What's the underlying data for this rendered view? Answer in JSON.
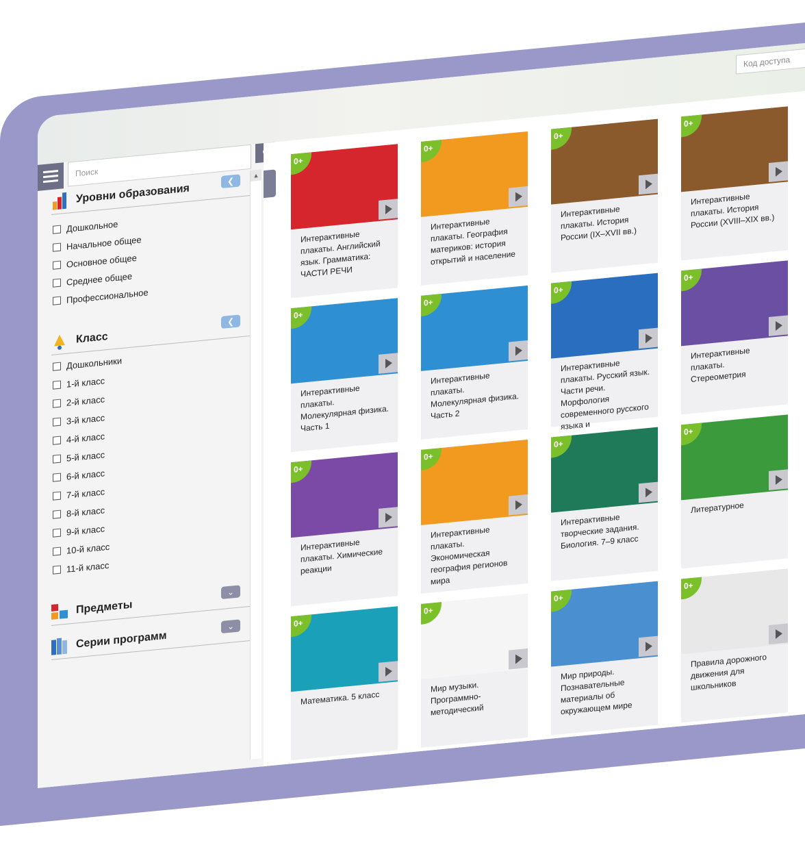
{
  "header": {
    "access_placeholder": "Код доступа"
  },
  "search": {
    "placeholder": "Поиск"
  },
  "sidebar": {
    "levels": {
      "title": "Уровни образования",
      "items": [
        "Дошкольное",
        "Начальное общее",
        "Основное общее",
        "Среднее общее",
        "Профессиональное"
      ]
    },
    "classes": {
      "title": "Класс",
      "items": [
        "Дошкольники",
        "1-й класс",
        "2-й класс",
        "3-й класс",
        "4-й класс",
        "5-й класс",
        "6-й класс",
        "7-й класс",
        "8-й класс",
        "9-й класс",
        "10-й класс",
        "11-й класс"
      ]
    },
    "subjects": {
      "title": "Предметы"
    },
    "series": {
      "title": "Серии программ"
    }
  },
  "badge_label": "0+",
  "cards": [
    {
      "title": "Интерактивные плакаты. Английский язык. Грамматика: ЧАСТИ РЕЧИ",
      "color": "#d5262d"
    },
    {
      "title": "Интерактивные плакаты. География материков: история открытий и население",
      "color": "#f29a1f"
    },
    {
      "title": "Интерактивные плакаты. История России (IX–XVII вв.)",
      "color": "#8a5a2c"
    },
    {
      "title": "Интерактивные плакаты. История России (XVIII–XIX вв.)",
      "color": "#8a5a2c"
    },
    {
      "title": "Интерактивные плакаты. Молекулярная физика. Часть 1",
      "color": "#2e8fd3"
    },
    {
      "title": "Интерактивные плакаты. Молекулярная физика. Часть 2",
      "color": "#2e8fd3"
    },
    {
      "title": "Интерактивные плакаты. Русский язык. Части речи. Морфология современного русского языка и",
      "color": "#2a6fbf"
    },
    {
      "title": "Интерактивные плакаты. Стереометрия",
      "color": "#6b4fa3"
    },
    {
      "title": "Интерактивные плакаты. Химические реакции",
      "color": "#7a4aa6"
    },
    {
      "title": "Интерактивные плакаты. Экономическая география регионов мира",
      "color": "#f29a1f"
    },
    {
      "title": "Интерактивные творческие задания. Биология. 7–9 класс",
      "color": "#1f7a5a"
    },
    {
      "title": "Литературное",
      "color": "#3b9a3b"
    },
    {
      "title": "Математика. 5 класс",
      "color": "#1aa0b8"
    },
    {
      "title": "Мир музыки. Программно-методический",
      "color": "#f5f5f5"
    },
    {
      "title": "Мир природы. Познавательные материалы об окружающем мире",
      "color": "#4a8fd0"
    },
    {
      "title": "Правила дорожного движения для школьников",
      "color": "#e8e8e8"
    }
  ]
}
